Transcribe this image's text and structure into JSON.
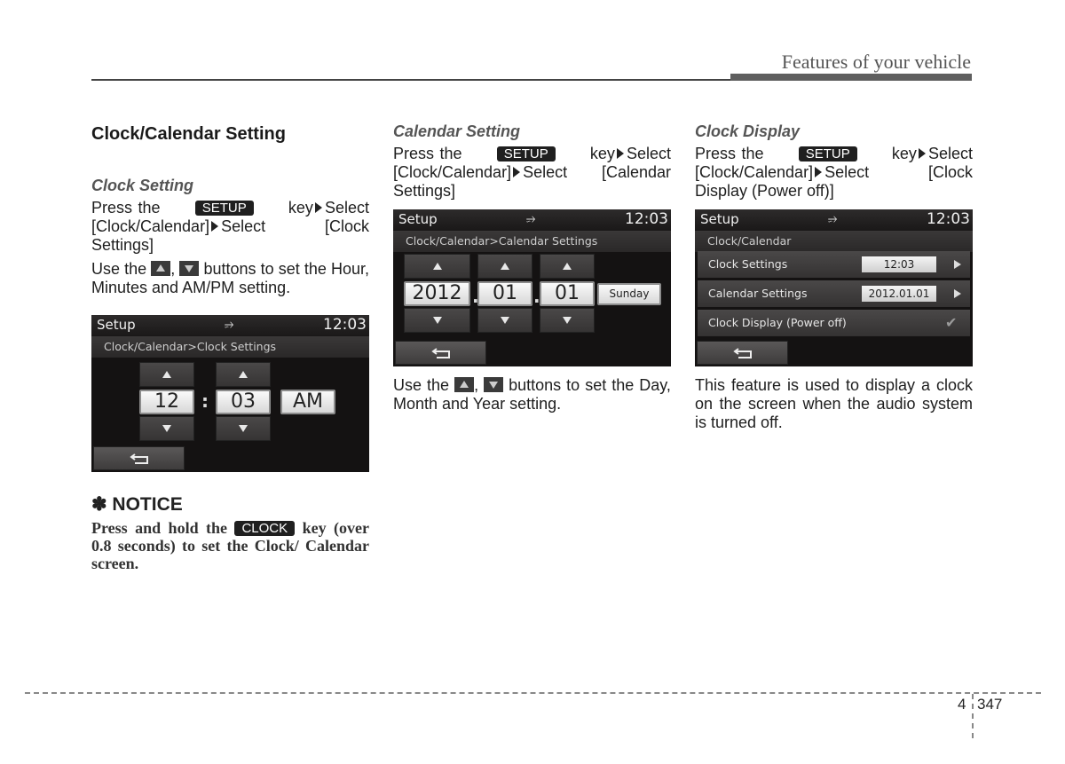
{
  "header": {
    "section_title": "Features of your vehicle"
  },
  "col1": {
    "heading": "Clock/Calendar Setting",
    "sub": "Clock Setting",
    "press": "Press the",
    "key": "SETUP",
    "key_select": "key",
    "select1": "Select",
    "path1": "[Clock/Calendar]",
    "select2": "Select [Clock Settings]",
    "use_pre": "Use the",
    "use_post": "buttons to set the Hour, Minutes and AM/PM setting.",
    "comma": ",",
    "screen": {
      "title": "Setup",
      "usb": "usb-icon",
      "time": "12:03",
      "crumb": "Clock/Calendar>Clock Settings",
      "hour": "12",
      "sep": ":",
      "minute": "03",
      "ampm": "AM"
    },
    "notice": {
      "heading": "✽ NOTICE",
      "pre": "Press and hold the",
      "key": "CLOCK",
      "post": "key (over 0.8 seconds) to set the Clock/ Calendar screen."
    }
  },
  "col2": {
    "sub": "Calendar Setting",
    "press": "Press the",
    "key": "SETUP",
    "key_select": "key",
    "select1": "Select",
    "path1": "[Clock/Calendar]",
    "select2": "Select [Calendar Settings]",
    "screen": {
      "title": "Setup",
      "time": "12:03",
      "crumb": "Clock/Calendar>Calendar Settings",
      "year": "2012",
      "month": "01",
      "day": "01",
      "dot": ".",
      "weekday": "Sunday"
    },
    "use_pre": "Use the",
    "use_post": "buttons to set the Day, Month and Year setting.",
    "comma": ","
  },
  "col3": {
    "sub": "Clock Display",
    "press": "Press the",
    "key": "SETUP",
    "key_select": "key",
    "select1": "Select",
    "path1": "[Clock/Calendar]",
    "select2": "Select [Clock Display (Power off)]",
    "screen": {
      "title": "Setup",
      "time": "12:03",
      "crumb": "Clock/Calendar",
      "rows": [
        {
          "label": "Clock Settings",
          "value": "12:03"
        },
        {
          "label": "Calendar Settings",
          "value": "2012.01.01"
        },
        {
          "label": "Clock Display (Power off)",
          "checked": "✔"
        }
      ]
    },
    "desc": "This feature is used to display a clock on the screen when the audio system is turned off."
  },
  "footer": {
    "chapter": "4",
    "page": "347"
  }
}
